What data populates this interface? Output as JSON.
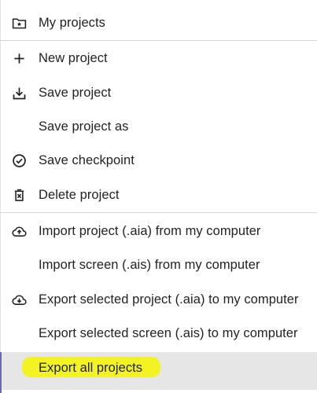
{
  "menu": {
    "items": [
      {
        "label": "My projects",
        "icon": "folder-star-icon"
      },
      {
        "label": "New project",
        "icon": "plus-icon"
      },
      {
        "label": "Save project",
        "icon": "download-tray-icon"
      },
      {
        "label": "Save project as",
        "icon": ""
      },
      {
        "label": "Save checkpoint",
        "icon": "check-circle-icon"
      },
      {
        "label": "Delete project",
        "icon": "trash-x-icon"
      },
      {
        "label": "Import project (.aia) from my computer",
        "icon": "cloud-upload-icon"
      },
      {
        "label": "Import screen (.ais) from my computer",
        "icon": ""
      },
      {
        "label": "Export selected project (.aia) to my computer",
        "icon": "cloud-download-icon"
      },
      {
        "label": "Export selected screen (.ais) to my computer",
        "icon": ""
      },
      {
        "label": "Export all projects",
        "icon": ""
      }
    ]
  },
  "colors": {
    "text": "#222222",
    "divider": "#d6d6d6",
    "selected_bg": "#e6e6e6",
    "marker_highlight": "#f4f400"
  }
}
